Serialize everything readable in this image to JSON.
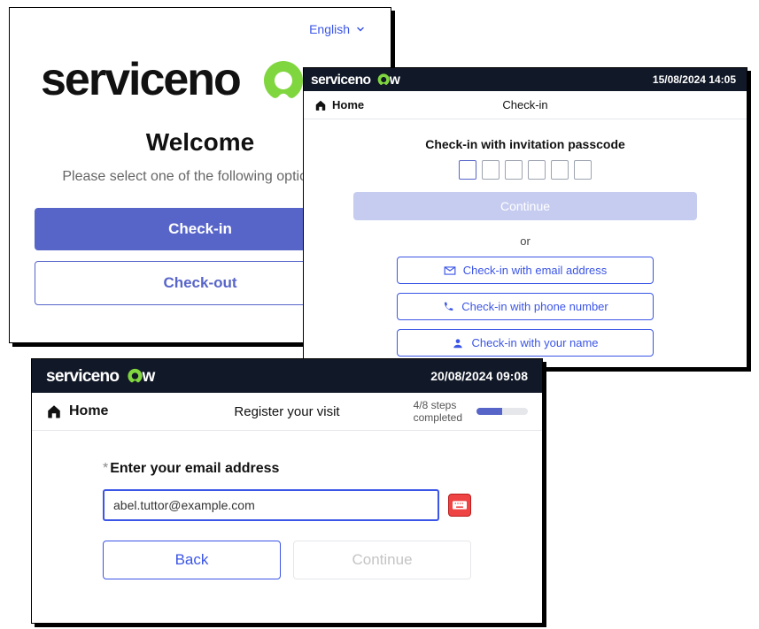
{
  "brand": {
    "name": "servicenow",
    "accent": "#80d63f",
    "ink": "#111827",
    "primary": "#5765c9",
    "link": "#3b55e6"
  },
  "card_a": {
    "language": "English",
    "title": "Welcome",
    "subtitle": "Please select one of the following options to",
    "checkin_label": "Check-in",
    "checkout_label": "Check-out"
  },
  "card_b": {
    "timestamp": "15/08/2024 14:05",
    "home_label": "Home",
    "page_title": "Check-in",
    "passcode_label": "Check-in with invitation passcode",
    "passcode_length": 6,
    "continue_label": "Continue",
    "or_label": "or",
    "alt_email": "Check-in with email address",
    "alt_phone": "Check-in with phone number",
    "alt_name": "Check-in with your name"
  },
  "card_c": {
    "timestamp": "20/08/2024 09:08",
    "home_label": "Home",
    "page_title": "Register your visit",
    "steps_done": 4,
    "steps_total": 8,
    "steps_text_line1": "4/8 steps",
    "steps_text_line2": "completed",
    "progress_percent": 50,
    "field_label": "Enter your email address",
    "email_value": "abel.tuttor@example.com",
    "back_label": "Back",
    "continue_label": "Continue"
  }
}
